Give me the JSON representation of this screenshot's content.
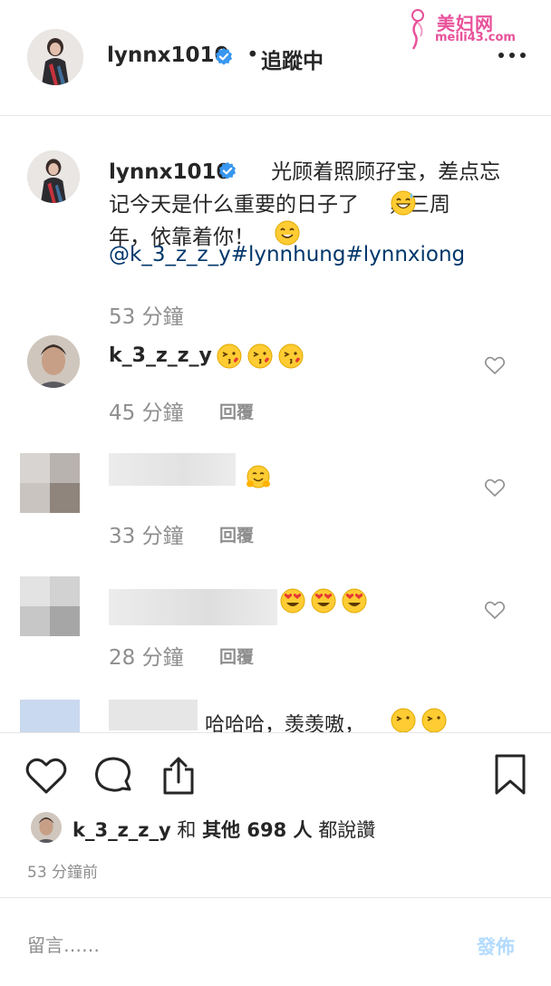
{
  "watermark": {
    "title": "美妇网",
    "url": "meili43.com"
  },
  "header": {
    "username": "lynnx1010",
    "separator": "•",
    "follow_status": "追蹤中",
    "more_icon": "more-horizontal-icon"
  },
  "post": {
    "author": "lynnx1010",
    "caption_line1": "光顾着照顾孖宝，差点忘",
    "caption_line2": "记今天是什么重要的日子了",
    "caption_line3a": "，三周",
    "caption_line3": "年，依靠着你！",
    "tags": "@k_3_z_z_y#lynnhung#lynnxiong",
    "time": "53 分鐘"
  },
  "comments": [
    {
      "username": "k_3_z_z_y",
      "emoji": [
        "kiss-heart-emoji",
        "kiss-heart-emoji",
        "kiss-heart-emoji"
      ],
      "time": "45 分鐘",
      "reply": "回覆"
    },
    {
      "username": "",
      "emoji": [
        "hug-emoji"
      ],
      "time": "33 分鐘",
      "reply": "回覆"
    },
    {
      "username": "",
      "emoji": [
        "heart-eyes-emoji",
        "heart-eyes-emoji",
        "heart-eyes-emoji"
      ],
      "time": "28 分鐘",
      "reply": "回覆"
    },
    {
      "username": "",
      "text": "哈哈哈，羡羡嗷，",
      "emoji": [
        "kiss-heart-emoji",
        "kiss-heart-emoji"
      ]
    }
  ],
  "actions": {
    "like_icon": "heart-icon",
    "comment_icon": "comment-icon",
    "share_icon": "share-icon",
    "save_icon": "bookmark-icon"
  },
  "likes": {
    "user": "k_3_z_z_y",
    "and": "和",
    "others": "其他 698 人",
    "suffix": "都說讚"
  },
  "time_ago": "53 分鐘前",
  "comment_input": {
    "placeholder": "留言……",
    "post_label": "發佈"
  },
  "colors": {
    "link": "#00376b",
    "muted": "#8e8e8e",
    "verified": "#3897f0",
    "post_disabled": "#b3dbff",
    "watermark": "#e8519a"
  }
}
